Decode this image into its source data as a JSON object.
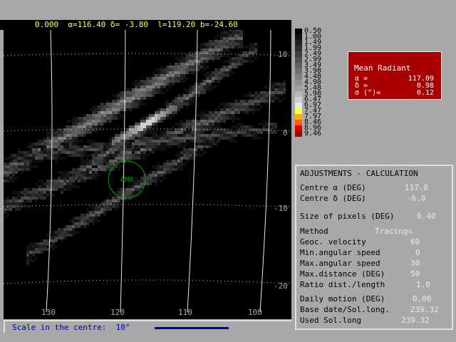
{
  "status": {
    "value": "0.000",
    "alpha": "α=116.40",
    "delta": "δ= -3.80",
    "l": "l=119.20",
    "b": "b=-24.60"
  },
  "axes": {
    "x_ticks": [
      "130",
      "120",
      "110",
      "100"
    ],
    "y_ticks": [
      "10",
      "0",
      "-10",
      "-20"
    ]
  },
  "map": {
    "marker_label": "AMO"
  },
  "legend": {
    "labels": [
      "0.50",
      "1.00",
      "1.49",
      "1.99",
      "2.49",
      "2.99",
      "3.49",
      "3.98",
      "4.48",
      "4.98",
      "5.48",
      "5.98",
      "6.47",
      "6.97",
      "7.47",
      "7.97",
      "8.46",
      "8.96",
      "9.46"
    ],
    "colors": [
      "#000000",
      "#101010",
      "#202020",
      "#303030",
      "#404040",
      "#505050",
      "#606060",
      "#707070",
      "#808080",
      "#909090",
      "#a0a0a0",
      "#b8b8b8",
      "#d0d0d0",
      "#e8e8e8",
      "#fcfc54",
      "#fcb000",
      "#fc6000",
      "#e00000",
      "#a80000"
    ]
  },
  "mean_radiant": {
    "title": "Mean Radiant",
    "rows": [
      {
        "label": "α =",
        "value": "117.09"
      },
      {
        "label": "δ =",
        "value": "0.98"
      },
      {
        "label": "σ (°)=",
        "value": "0.12"
      }
    ]
  },
  "adjustments": {
    "title": "ADJUSTMENTS - CALCULATION",
    "centre_alpha_label": "Centre α (DEG)",
    "centre_alpha_value": "117.0",
    "centre_delta_label": "Centre δ (DEG)",
    "centre_delta_value": "-6.0",
    "pixel_size_label": "Size of pixels (DEG)",
    "pixel_size_value": "0.40",
    "method_label": "Method",
    "method_value": "Tracings",
    "geoc_velocity_label": "Geoc. velocity",
    "geoc_velocity_value": "60",
    "min_speed_label": "Min.angular speed",
    "min_speed_value": "0",
    "max_speed_label": "Max.angular speed",
    "max_speed_value": "30",
    "max_distance_label": "Max.distance (DEG)",
    "max_distance_value": "50",
    "ratio_label": "Ratio dist./length",
    "ratio_value": "1.0",
    "daily_motion_label": "Daily motion (DEG)",
    "daily_motion_value": "0.00",
    "base_date_label": "Base date/Sol.long.",
    "base_date_value": "239.32",
    "used_sol_label": "Used Sol.long",
    "used_sol_value": "239.32"
  },
  "scale": {
    "text": "Scale in the centre:  10°"
  },
  "colors": {
    "plot_bg": "#000000",
    "panel_bg": "#a8a8a8",
    "mean_panel_bg": "#a80000",
    "status_text": "#fcfc54",
    "marker": "#00a800",
    "scale_text": "#0000a8"
  }
}
